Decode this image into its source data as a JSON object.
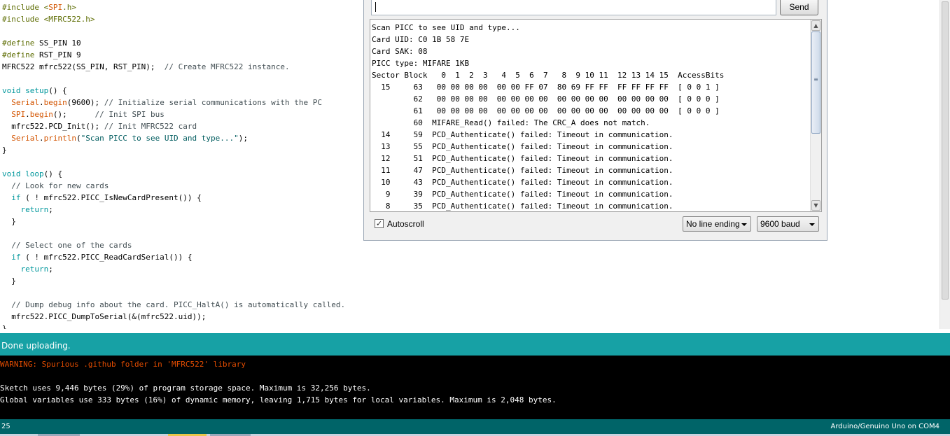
{
  "editor": {
    "code_lines": [
      [
        [
          "pre",
          "#include <"
        ],
        [
          "fn",
          "SPI"
        ],
        [
          "pre",
          ".h>"
        ]
      ],
      [
        [
          "pre",
          "#include <MFRC522.h>"
        ]
      ],
      [],
      [
        [
          "pre",
          "#define"
        ],
        [
          "pl",
          " SS_PIN 10"
        ]
      ],
      [
        [
          "pre",
          "#define"
        ],
        [
          "pl",
          " RST_PIN 9"
        ]
      ],
      [
        [
          "pl",
          "MFRC522 mfrc522(SS_PIN, RST_PIN);  "
        ],
        [
          "cm",
          "// Create MFRC522 instance."
        ]
      ],
      [],
      [
        [
          "kw",
          "void"
        ],
        [
          "pl",
          " "
        ],
        [
          "kw",
          "setup"
        ],
        [
          "pl",
          "() {"
        ]
      ],
      [
        [
          "pl",
          "  "
        ],
        [
          "fn",
          "Serial"
        ],
        [
          "pl",
          "."
        ],
        [
          "fn",
          "begin"
        ],
        [
          "pl",
          "(9600); "
        ],
        [
          "cm",
          "// Initialize serial communications with the PC"
        ]
      ],
      [
        [
          "pl",
          "  "
        ],
        [
          "fn",
          "SPI"
        ],
        [
          "pl",
          "."
        ],
        [
          "fn",
          "begin"
        ],
        [
          "pl",
          "();      "
        ],
        [
          "cm",
          "// Init SPI bus"
        ]
      ],
      [
        [
          "pl",
          "  mfrc522.PCD_Init(); "
        ],
        [
          "cm",
          "// Init MFRC522 card"
        ]
      ],
      [
        [
          "pl",
          "  "
        ],
        [
          "fn",
          "Serial"
        ],
        [
          "pl",
          "."
        ],
        [
          "fn",
          "println"
        ],
        [
          "pl",
          "("
        ],
        [
          "str",
          "\"Scan PICC to see UID and type...\""
        ],
        [
          "pl",
          ");"
        ]
      ],
      [
        [
          "pl",
          "}"
        ]
      ],
      [],
      [
        [
          "kw",
          "void"
        ],
        [
          "pl",
          " "
        ],
        [
          "kw",
          "loop"
        ],
        [
          "pl",
          "() {"
        ]
      ],
      [
        [
          "pl",
          "  "
        ],
        [
          "cm",
          "// Look for new cards"
        ]
      ],
      [
        [
          "pl",
          "  "
        ],
        [
          "kw",
          "if"
        ],
        [
          "pl",
          " ( ! mfrc522.PICC_IsNewCardPresent()) {"
        ]
      ],
      [
        [
          "pl",
          "    "
        ],
        [
          "kw",
          "return"
        ],
        [
          "pl",
          ";"
        ]
      ],
      [
        [
          "pl",
          "  }"
        ]
      ],
      [],
      [
        [
          "pl",
          "  "
        ],
        [
          "cm",
          "// Select one of the cards"
        ]
      ],
      [
        [
          "pl",
          "  "
        ],
        [
          "kw",
          "if"
        ],
        [
          "pl",
          " ( ! mfrc522.PICC_ReadCardSerial()) {"
        ]
      ],
      [
        [
          "pl",
          "    "
        ],
        [
          "kw",
          "return"
        ],
        [
          "pl",
          ";"
        ]
      ],
      [
        [
          "pl",
          "  }"
        ]
      ],
      [],
      [
        [
          "pl",
          "  "
        ],
        [
          "cm",
          "// Dump debug info about the card. PICC_HaltA() is automatically called."
        ]
      ],
      [
        [
          "pl",
          "  mfrc522.PICC_DumpToSerial(&(mfrc522.uid));"
        ]
      ],
      [
        [
          "pl",
          "}"
        ]
      ]
    ]
  },
  "serial_monitor": {
    "input_value": "",
    "send_label": "Send",
    "output_lines": [
      "Scan PICC to see UID and type...",
      "Card UID: C0 1B 58 7E",
      "Card SAK: 08",
      "PICC type: MIFARE 1KB",
      "Sector Block   0  1  2  3   4  5  6  7   8  9 10 11  12 13 14 15  AccessBits",
      "  15     63   00 00 00 00  00 00 FF 07  80 69 FF FF  FF FF FF FF  [ 0 0 1 ]",
      "         62   00 00 00 00  00 00 00 00  00 00 00 00  00 00 00 00  [ 0 0 0 ]",
      "         61   00 00 00 00  00 00 00 00  00 00 00 00  00 00 00 00  [ 0 0 0 ]",
      "         60  MIFARE_Read() failed: The CRC_A does not match.",
      "  14     59  PCD_Authenticate() failed: Timeout in communication.",
      "  13     55  PCD_Authenticate() failed: Timeout in communication.",
      "  12     51  PCD_Authenticate() failed: Timeout in communication.",
      "  11     47  PCD_Authenticate() failed: Timeout in communication.",
      "  10     43  PCD_Authenticate() failed: Timeout in communication.",
      "   9     39  PCD_Authenticate() failed: Timeout in communication.",
      "   8     35  PCD_Authenticate() failed: Timeout in communication."
    ],
    "autoscroll_label": "Autoscroll",
    "autoscroll_checked": true,
    "line_ending": "No line ending",
    "baud_rate": "9600 baud"
  },
  "status": {
    "message": "Done uploading."
  },
  "console": {
    "lines": [
      "WARNING: Spurious .github folder in 'MFRC522' library",
      "",
      "Sketch uses 9,446 bytes (29%) of program storage space. Maximum is 32,256 bytes.",
      "Global variables use 333 bytes (16%) of dynamic memory, leaving 1,715 bytes for local variables. Maximum is 2,048 bytes."
    ]
  },
  "footer": {
    "line_number": "25",
    "board": "Arduino/Genuino Uno on COM4"
  },
  "colors": {
    "status_teal": "#17a1a5",
    "footer_teal": "#006468",
    "warning_orange": "#e34c00",
    "keyword": "#00979c",
    "function": "#d35400",
    "preprocessor": "#5e6d03",
    "comment": "#434f54"
  },
  "icons": {
    "scroll_up": "chevron-up-icon",
    "scroll_down": "chevron-down-icon",
    "checkbox": "checkmark-icon",
    "dropdown": "triangle-down-icon"
  }
}
